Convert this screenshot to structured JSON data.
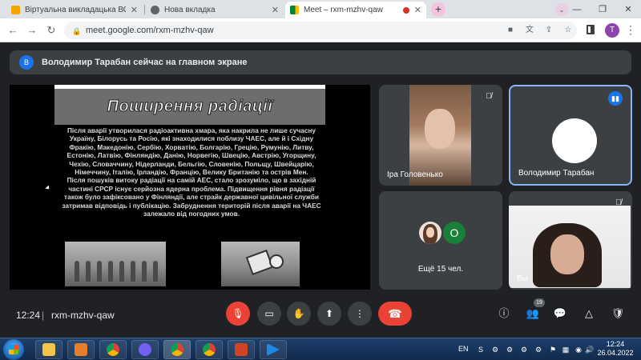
{
  "browser": {
    "tabs": [
      {
        "title": "Віртуальна викладацька ВСП \"Б",
        "icon_color": "#f2a600"
      },
      {
        "title": "Нова вкладка",
        "icon_color": "#5f6368"
      },
      {
        "title": "Meet – rxm-mzhv-qaw",
        "icon_color": "#00832d",
        "recording": true
      }
    ],
    "new_tab_label": "+",
    "address": "meet.google.com/rxm-mzhv-qaw",
    "profile_initial": "T",
    "window_controls": {
      "minimize": "—",
      "restore": "❐",
      "close": "✕"
    }
  },
  "meet": {
    "banner": {
      "initial": "В",
      "text": "Володимир Тарабан сейчас на главном экране"
    },
    "slide": {
      "title": "Поширення радіації",
      "paragraphs": [
        "Після аварії утворилася радіоактивна хмара, яка накрила не лише сучасну Україну, Білорусь та Росію, які знаходилися поблизу ЧАЕС, але й і Східну Фракію, Македонію, Сербію, Хорватію, Болгарію, Грецію, Румунію, Литву, Естонію, Латвію, Фінляндію, Данію, Норвегію, Швецію, Австрію, Угорщину, Чехію, Словаччину, Нідерланди, Бельгію, Словенію, Польщу, Швейцарію, Німеччину, Італію, Ірландію, Францію, Велику Британію та острів Мен.",
        "Після пошуків витоку радіації на самій АЕС, стало зрозуміло, що в західній частині СРСР існує серйозна ядерна проблема. Підвищення рівня радіації також було зафіксовано у Фінляндії, але страйк державної цивільної служби затримав відповідь і публікацію. Забруднення територій після аварії на ЧАЕС залежало від погодних умов."
      ]
    },
    "participants": [
      {
        "name": "Іра Головенько"
      },
      {
        "name": "Володимир Тарабан"
      },
      {
        "name": "Ещё 15 чел.",
        "avatar_initial": "О"
      },
      {
        "name": "Вы"
      }
    ],
    "controls": {
      "time": "12:24",
      "separator": "|",
      "meeting_code": "rxm-mzhv-qaw",
      "participant_count": "19"
    }
  },
  "taskbar": {
    "language": "EN",
    "time": "12:24",
    "date": "26.04.2022"
  }
}
